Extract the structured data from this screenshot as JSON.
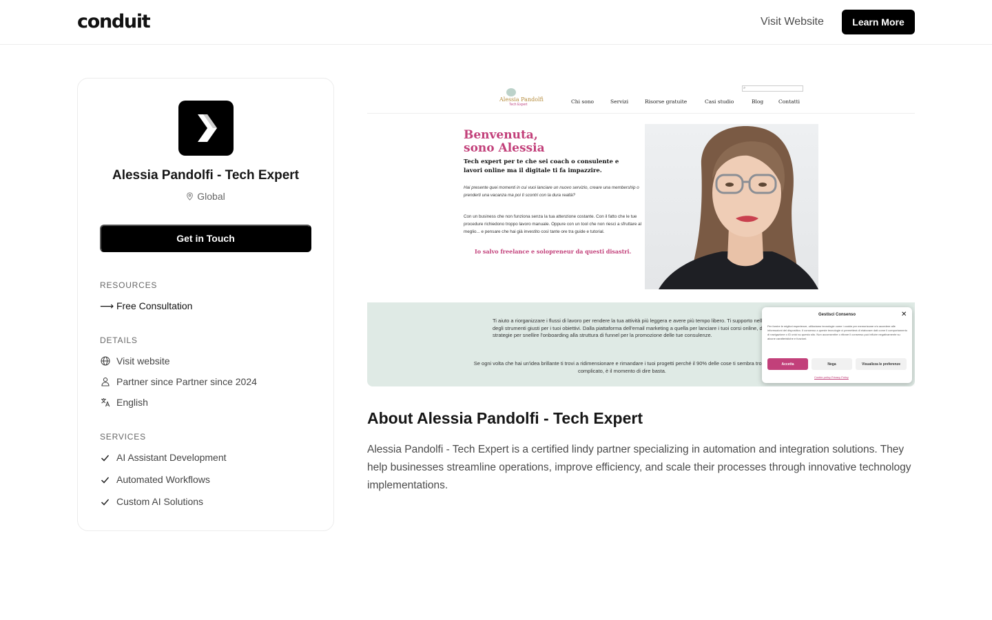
{
  "header": {
    "logo": "conduit",
    "visit_website": "Visit Website",
    "learn_more": "Learn More"
  },
  "profile": {
    "name": "Alessia Pandolfi - Tech Expert",
    "location": "Global",
    "cta": "Get in Touch",
    "resources_label": "RESOURCES",
    "resources": [
      {
        "label": "⟶ Free Consultation"
      }
    ],
    "details_label": "DETAILS",
    "details": [
      {
        "icon": "globe-icon",
        "label": "Visit website"
      },
      {
        "icon": "users-icon",
        "label": "Partner since Partner since 2024"
      },
      {
        "icon": "translate-icon",
        "label": "English"
      }
    ],
    "services_label": "SERVICES",
    "services": [
      {
        "icon": "check-icon",
        "label": "AI Assistant Development"
      },
      {
        "icon": "check-icon",
        "label": "Automated Workflows"
      },
      {
        "icon": "check-icon",
        "label": "Custom AI Solutions"
      }
    ]
  },
  "preview": {
    "brand": "Alessia Pandolfi",
    "brand_sub": "Tech Expert",
    "menu": [
      "Chi sono",
      "Servizi",
      "Risorse gratuite",
      "Casi studio",
      "Blog",
      "Contatti"
    ],
    "heading_line1": "Benvenuta,",
    "heading_line2": "sono Alessia",
    "subheading": "Tech expert per te che sei coach o consulente e lavori online ma il digitale ti fa impazzire.",
    "para1": "Hai presente quei momenti in cui vuoi lanciare un nuovo servizio, creare una membership o prenderti una vacanza ma poi ti scontri con la dura realtà?",
    "para2": "Con un business che non funziona senza la tua attenzione costante. Con il fatto che le tue procedure richiedono troppo lavoro manuale. Oppure con un tool che non riesci a sfruttare al meglio... e pensare che hai già investito così tante ore tra guide e tutorial.",
    "tagline": "Io salvo freelance e solopreneur da questi disastri.",
    "band_para1": "Ti aiuto a riorganizzare i flussi di lavoro per rendere la tua attività più leggera e avere più tempo libero. Ti supporto nella scelta degli strumenti giusti per i tuoi obiettivi. Dalla piattaforma dell'email marketing a quella per lanciare i tuoi corsi online, dalle strategie per snellire l'onboarding alla struttura di funnel per la promozione delle tue consulenze.",
    "band_para2": "Se ogni volta che hai un'idea brillante ti trovi a ridimensionare e rimandare i tuoi progetti perché il 90% delle cose ti sembra troppo complicato, è il momento di dire basta.",
    "consent": {
      "title": "Gestisci Consenso",
      "close": "✕",
      "text": "Per fornire le migliori esperienze, utilizziamo tecnologie come i cookie per memorizzare e/o accedere alle informazioni del dispositivo. Il consenso a queste tecnologie ci permetterà di elaborare dati come il comportamento di navigazione o ID unici su questo sito. Non acconsentire o ritirare il consenso può influire negativamente su alcune caratteristiche e funzioni.",
      "accept": "Accetta",
      "deny": "Nega",
      "prefs": "Visualizza le preferenze",
      "links": "Cookie policy   Privacy Policy",
      "accent": "#c2407a"
    }
  },
  "about": {
    "title": "About Alessia Pandolfi - Tech Expert",
    "text": "Alessia Pandolfi - Tech Expert is a certified lindy partner specializing in automation and integration solutions. They help businesses streamline operations, improve efficiency, and scale their processes through innovative technology implementations."
  }
}
